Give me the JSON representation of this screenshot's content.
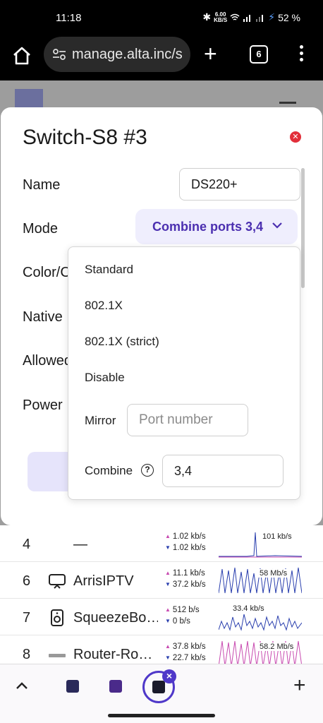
{
  "status_bar": {
    "time": "11:18",
    "net_speed": "6.00",
    "net_unit": "KB/S",
    "battery": "52 %"
  },
  "browser": {
    "url": "manage.alta.inc/s",
    "tab_count": "6"
  },
  "modal": {
    "title": "Switch-S8 #3",
    "labels": {
      "name": "Name",
      "mode": "Mode",
      "color": "Color/C",
      "native": "Native ",
      "allowed": "Allowed",
      "power": "Power "
    },
    "name_value": "DS220+",
    "mode_value": "Combine ports 3,4"
  },
  "dropdown": {
    "options": [
      "Standard",
      "802.1X",
      "802.1X (strict)",
      "Disable"
    ],
    "mirror_label": "Mirror",
    "mirror_placeholder": "Port number",
    "combine_label": "Combine",
    "combine_value": "3,4"
  },
  "ports": [
    {
      "num": "4",
      "name": "—",
      "up": "1.02 kb/s",
      "down": "1.02 kb/s",
      "peak": "101 kb/s"
    },
    {
      "num": "6",
      "name": "ArrisIPTV",
      "up": "11.1 kb/s",
      "down": "37.2 kb/s",
      "peak": "58 Mb/s"
    },
    {
      "num": "7",
      "name": "SqueezeBo…",
      "up": "512 b/s",
      "down": "0 b/s",
      "peak": "33.4 kb/s"
    },
    {
      "num": "8",
      "name": "Router-Ro…",
      "up": "37.8 kb/s",
      "down": "22.7 kb/s",
      "peak": "58.2 Mb/s"
    }
  ],
  "colors": {
    "accent": "#4f38c9",
    "close": "#e22f3a",
    "upload": "#c84ab0",
    "download": "#2a3fae"
  }
}
